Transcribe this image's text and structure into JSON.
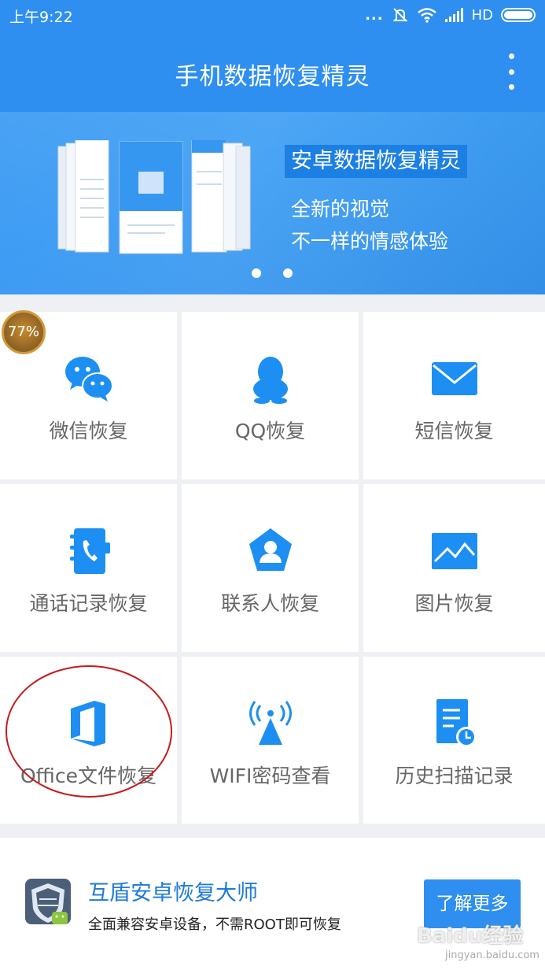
{
  "status_bar": {
    "time": "上午9:22",
    "dots": "...",
    "network": "HD"
  },
  "app_bar": {
    "title": "手机数据恢复精灵"
  },
  "banner": {
    "headline": "安卓数据恢复精灵",
    "line1": "全新的视觉",
    "line2": "不一样的情感体验"
  },
  "badge": {
    "text": "77%"
  },
  "tiles": [
    {
      "label": "微信恢复",
      "icon": "wechat-icon"
    },
    {
      "label": "QQ恢复",
      "icon": "qq-icon"
    },
    {
      "label": "短信恢复",
      "icon": "sms-envelope-icon"
    },
    {
      "label": "通话记录恢复",
      "icon": "call-log-icon"
    },
    {
      "label": "联系人恢复",
      "icon": "contacts-icon"
    },
    {
      "label": "图片恢复",
      "icon": "picture-icon"
    },
    {
      "label": "Office文件恢复",
      "icon": "office-icon"
    },
    {
      "label": "WIFI密码查看",
      "icon": "wifi-signal-icon"
    },
    {
      "label": "历史扫描记录",
      "icon": "history-document-icon"
    }
  ],
  "promo": {
    "title": "互盾安卓恢复大师",
    "description": "全面兼容安卓设备，不需ROOT即可恢复",
    "button": "了解更多"
  },
  "watermark": {
    "text": "Baidu经验",
    "sub": "jingyan.baidu.com"
  },
  "colors": {
    "primary": "#2e8ff0",
    "accent_dark": "#1c7fe3",
    "tile_label": "#666666",
    "highlight_circle": "#c41b1b"
  }
}
